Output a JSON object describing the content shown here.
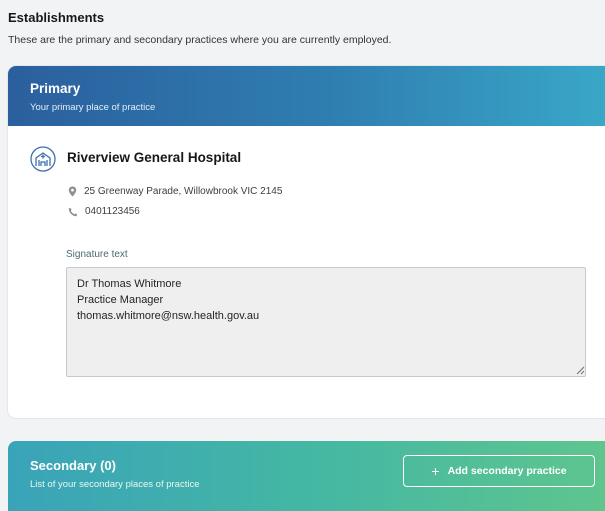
{
  "page": {
    "title": "Establishments",
    "subtitle": "These are the primary and secondary practices where you are currently employed."
  },
  "primary": {
    "title": "Primary",
    "subtitle": "Your primary place of practice",
    "hospital_icon": "hospital-building-icon",
    "establishment_name": "Riverview General Hospital",
    "address": "25 Greenway Parade, Willowbrook VIC 2145",
    "phone": "0401123456",
    "signature_label": "Signature text",
    "signature_value": "Dr Thomas Whitmore\nPractice Manager\nthomas.whitmore@nsw.health.gov.au"
  },
  "secondary": {
    "title": "Secondary (0)",
    "subtitle": "List of your secondary places of practice",
    "add_button_label": "Add secondary practice",
    "add_button_icon": "plus-icon"
  },
  "colors": {
    "primary_header_start": "#2b5f9e",
    "primary_header_end": "#39a7c8",
    "secondary_header_start": "#3aa3b9",
    "secondary_header_end": "#5ec58e"
  }
}
